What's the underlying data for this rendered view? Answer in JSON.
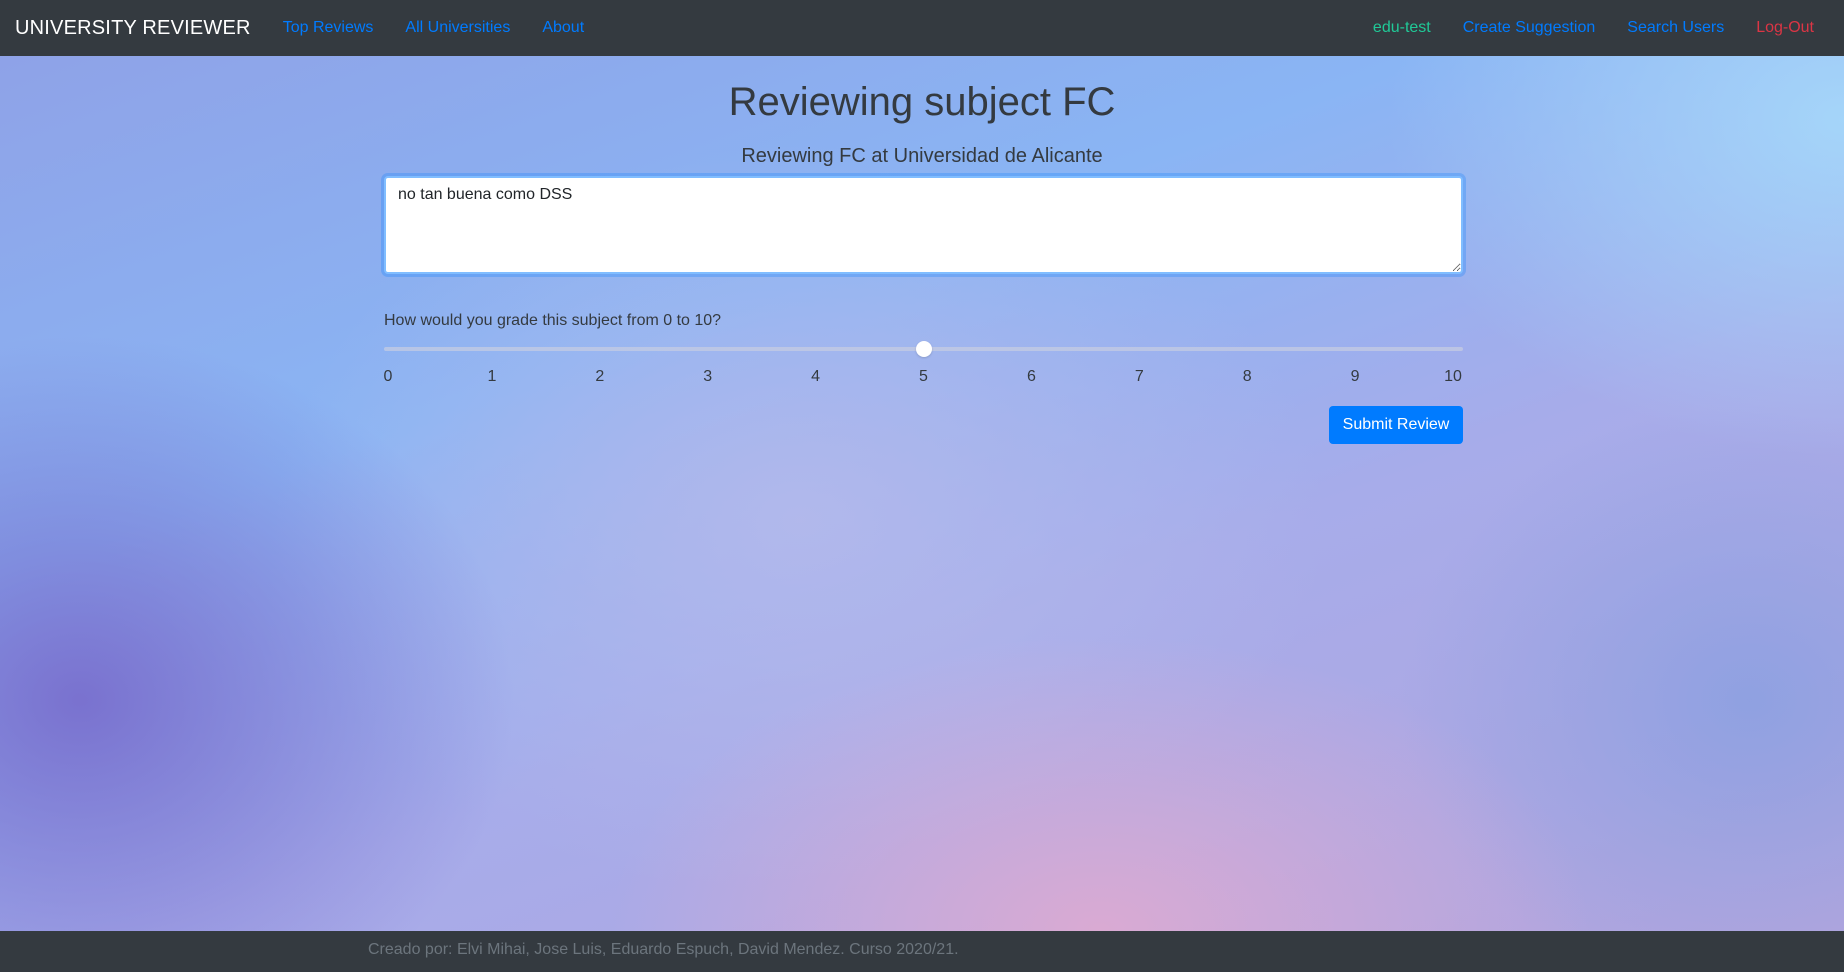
{
  "navbar": {
    "brand": "UNIVERSITY REVIEWER",
    "left_links": [
      "Top Reviews",
      "All Universities",
      "About"
    ],
    "user": "edu-test",
    "right_links": [
      "Create Suggestion",
      "Search Users"
    ],
    "logout": "Log-Out"
  },
  "main": {
    "title": "Reviewing subject FC",
    "subtitle": "Reviewing FC at Universidad de Alicante",
    "review_text": "no tan buena como DSS",
    "grade_question": "How would you grade this subject from 0 to 10?",
    "slider": {
      "min": 0,
      "max": 10,
      "value": 5,
      "tick_labels": [
        "0",
        "1",
        "2",
        "3",
        "4",
        "5",
        "6",
        "7",
        "8",
        "9",
        "10"
      ]
    },
    "submit_label": "Submit Review"
  },
  "footer": {
    "text": "Creado por: Elvi Mihai, Jose Luis, Eduardo Espuch, David Mendez. Curso 2020/21."
  },
  "colors": {
    "navbar_bg": "#343a40",
    "link": "#007bff",
    "user_link": "#20c997",
    "logout_link": "#dc3545",
    "button": "#007bff"
  }
}
